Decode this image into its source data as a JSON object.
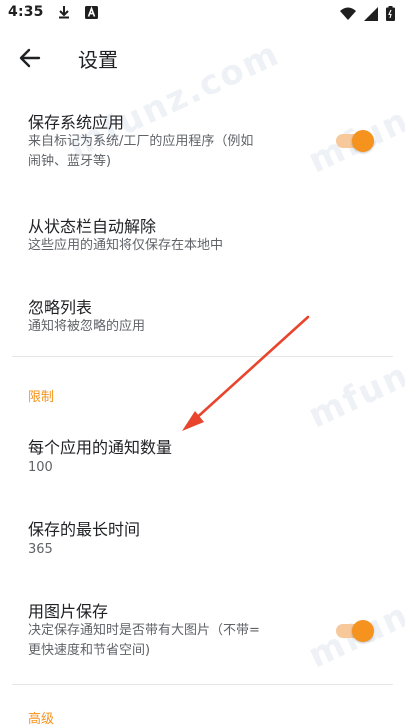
{
  "status_bar": {
    "time": "4:35",
    "icons": [
      "download-icon",
      "notification-a-icon",
      "wifi-icon",
      "signal-icon",
      "battery-icon"
    ]
  },
  "app_bar": {
    "title": "设置"
  },
  "watermark_text": "mfunz.com",
  "items": [
    {
      "label": "保存系统应用",
      "sub": "来自标记为系统/工厂的应用程序（例如\n闹钟、蓝牙等)",
      "toggle_on": true
    },
    {
      "label": "从状态栏自动解除",
      "sub": "这些应用的通知将仅保存在本地中"
    },
    {
      "label": "忽略列表",
      "sub": "通知将被忽略的应用"
    }
  ],
  "section_limits": "限制",
  "limit_items": [
    {
      "label": "每个应用的通知数量",
      "value": "100"
    },
    {
      "label": "保存的最长时间",
      "value": "365"
    },
    {
      "label": "用图片保存",
      "sub": "决定保存通知时是否带有大图片（不带=\n更快速度和节省空间)",
      "toggle_on": true
    }
  ],
  "section_advanced": "高级",
  "colors": {
    "accent": "#f5931e",
    "accent_track": "#f6c89a",
    "annotation_arrow": "#e8452c"
  }
}
